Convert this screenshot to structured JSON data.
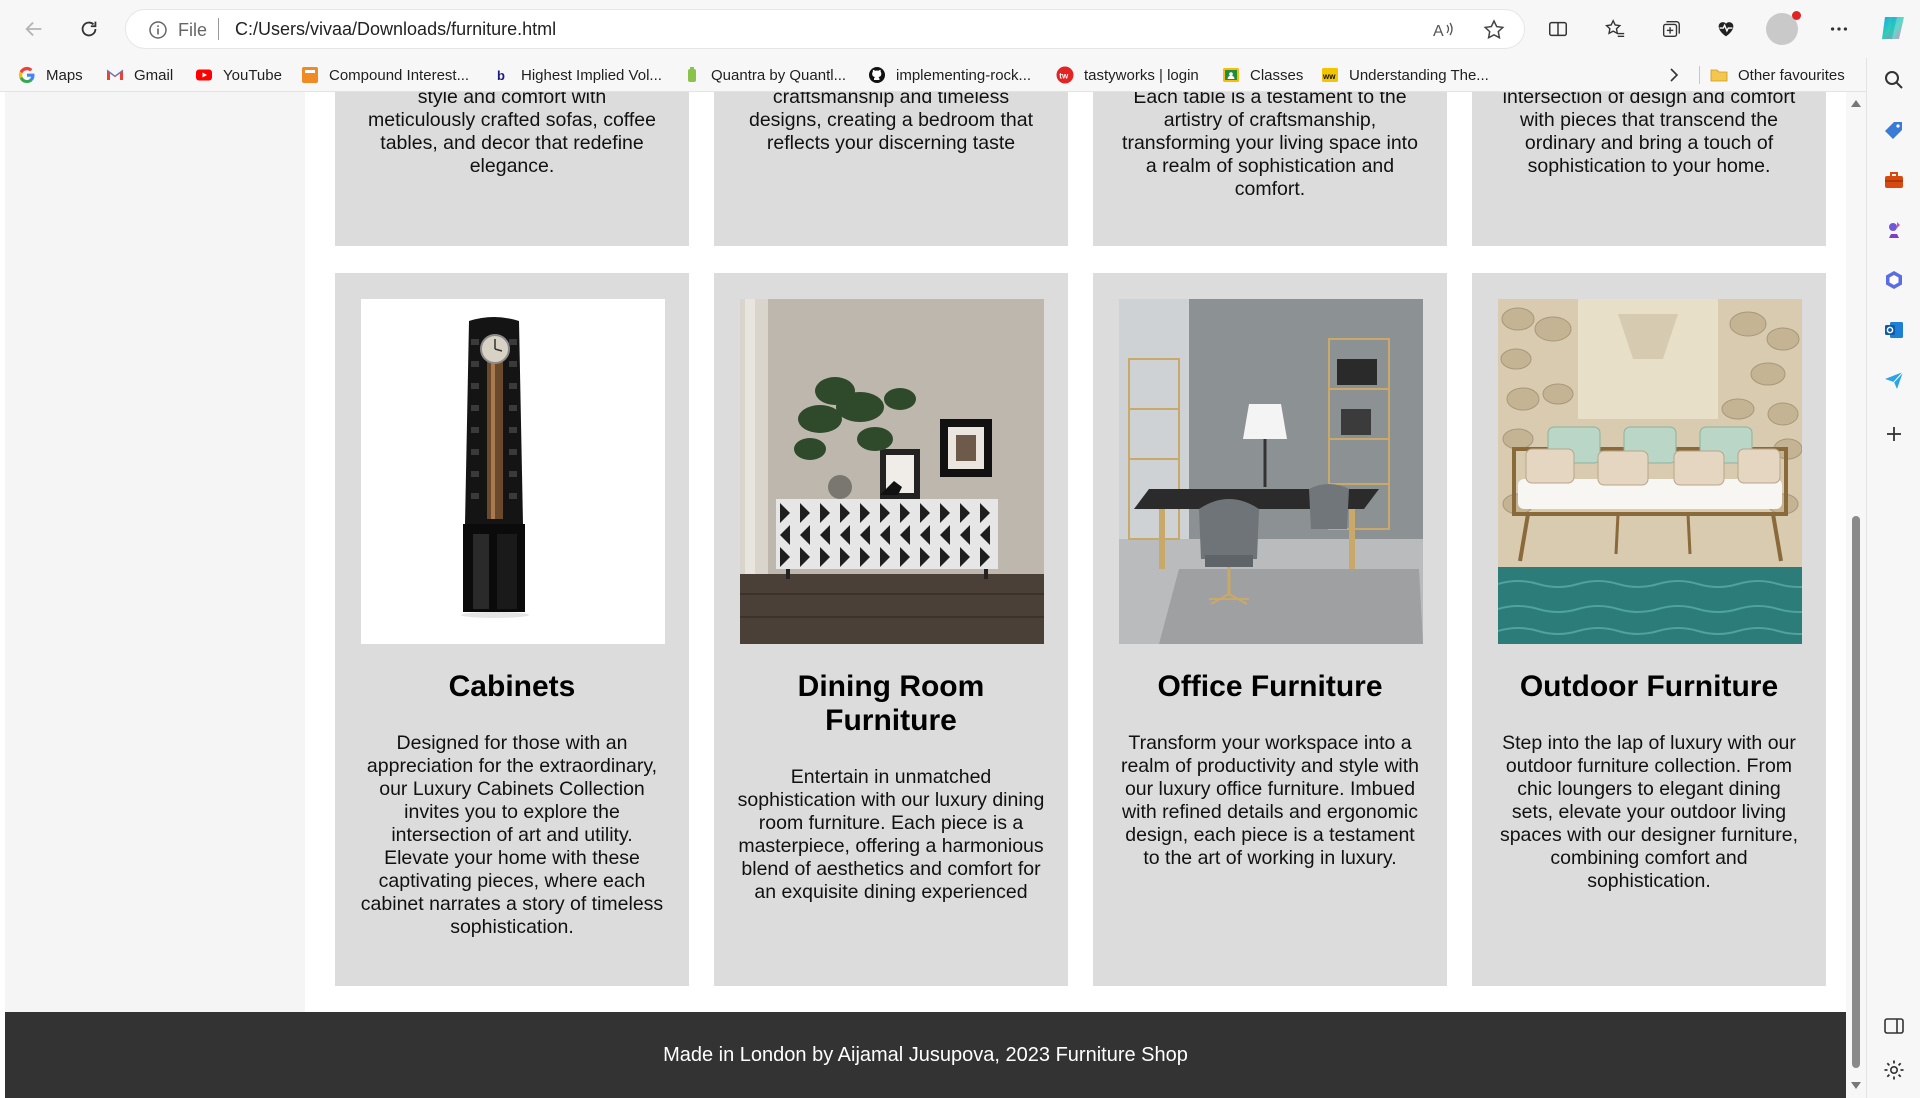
{
  "browser": {
    "address": {
      "scheme": "File",
      "url": "C:/Users/vivaa/Downloads/furniture.html"
    },
    "bookmarks": [
      {
        "label": "Maps",
        "icon": "google-icon"
      },
      {
        "label": "Gmail",
        "icon": "gmail-icon"
      },
      {
        "label": "YouTube",
        "icon": "youtube-icon"
      },
      {
        "label": "Compound Interest...",
        "icon": "calculator-site-icon"
      },
      {
        "label": "Highest Implied Vol...",
        "icon": "bing-icon"
      },
      {
        "label": "Quantra by Quantl...",
        "icon": "quantra-icon"
      },
      {
        "label": "implementing-rock...",
        "icon": "github-icon"
      },
      {
        "label": "tastyworks | login",
        "icon": "tastyworks-icon"
      },
      {
        "label": "Classes",
        "icon": "classroom-icon"
      },
      {
        "label": "Understanding The...",
        "icon": "wwf-icon"
      }
    ],
    "other_favourites": "Other favourites"
  },
  "page": {
    "top_cards": [
      {
        "desc": [
          "style and comfort with",
          "meticulously crafted sofas, coffee",
          "tables, and decor that redefine",
          "elegance."
        ]
      },
      {
        "desc": [
          "craftsmanship and timeless",
          "designs, creating a bedroom that",
          "reflects your discerning taste"
        ]
      },
      {
        "desc": [
          "Each table is a testament to the",
          "artistry of craftsmanship,",
          "transforming your living space into",
          "a realm of sophistication and",
          "comfort."
        ]
      },
      {
        "desc": [
          "intersection of design and comfort",
          "with pieces that transcend the",
          "ordinary and bring a touch of",
          "sophistication to your home."
        ]
      }
    ],
    "cards": [
      {
        "title": "Cabinets",
        "image": "luxury-cabinet-image",
        "desc": "Designed for those with an appreciation for the extraordinary, our Luxury Cabinets Collection invites you to explore the intersection of art and utility. Elevate your home with these captivating pieces, where each cabinet narrates a story of timeless sophistication."
      },
      {
        "title": "Dining Room Furniture",
        "image": "dining-sideboard-image",
        "desc": "Entertain in unmatched sophistication with our luxury dining room furniture. Each piece is a masterpiece, offering a harmonious blend of aesthetics and comfort for an exquisite dining experienced"
      },
      {
        "title": "Office Furniture",
        "image": "office-desk-image",
        "desc": "Transform your workspace into a realm of productivity and style with our luxury office furniture. Imbued with refined details and ergonomic design, each piece is a testament to the art of working in luxury."
      },
      {
        "title": "Outdoor Furniture",
        "image": "outdoor-sofa-image",
        "desc": "Step into the lap of luxury with our outdoor furniture collection. From chic loungers to elegant dining sets, elevate your outdoor living spaces with our designer furniture, combining comfort and sophistication."
      }
    ],
    "footer": "Made in London by Aijamal Jusupova, 2023 Furniture Shop"
  },
  "colors": {
    "card_bg": "#dcdcdc",
    "footer_bg": "#333333",
    "page_bg": "#ffffff"
  }
}
